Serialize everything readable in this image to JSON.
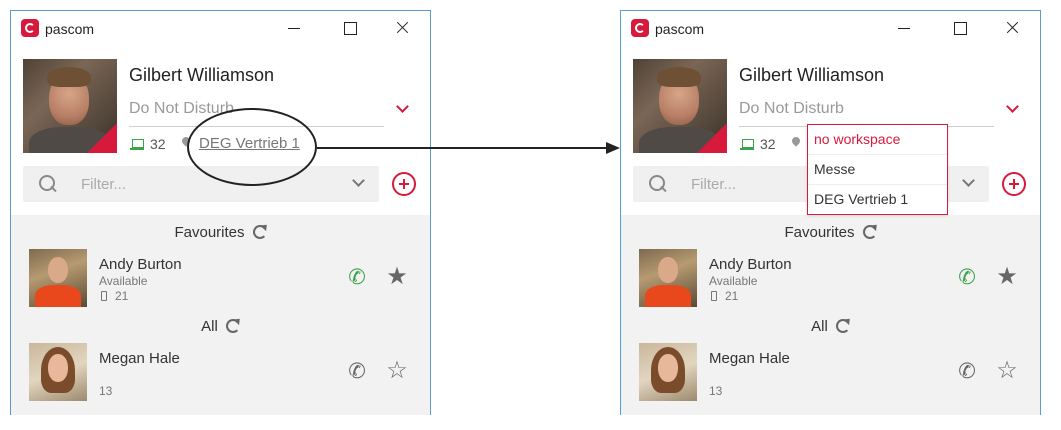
{
  "app": {
    "name": "pascom"
  },
  "profile": {
    "name": "Gilbert Williamson",
    "status": "Do Not Disturb",
    "extension": "32",
    "workspace": "DEG Vertrieb 1"
  },
  "search": {
    "placeholder": "Filter..."
  },
  "favourites": {
    "label": "Favourites",
    "contacts": [
      {
        "name": "Andy Burton",
        "status": "Available",
        "extension": "21"
      }
    ]
  },
  "all": {
    "label": "All",
    "contacts": [
      {
        "name": "Megan Hale",
        "extension": "13"
      }
    ]
  },
  "workspace_menu": {
    "options": [
      "no workspace",
      "Messe",
      "DEG Vertrieb 1"
    ],
    "selected": "no workspace"
  },
  "colors": {
    "accent": "#d7193c",
    "call_green": "#3aa44a",
    "window_border": "#5a9bd5"
  }
}
